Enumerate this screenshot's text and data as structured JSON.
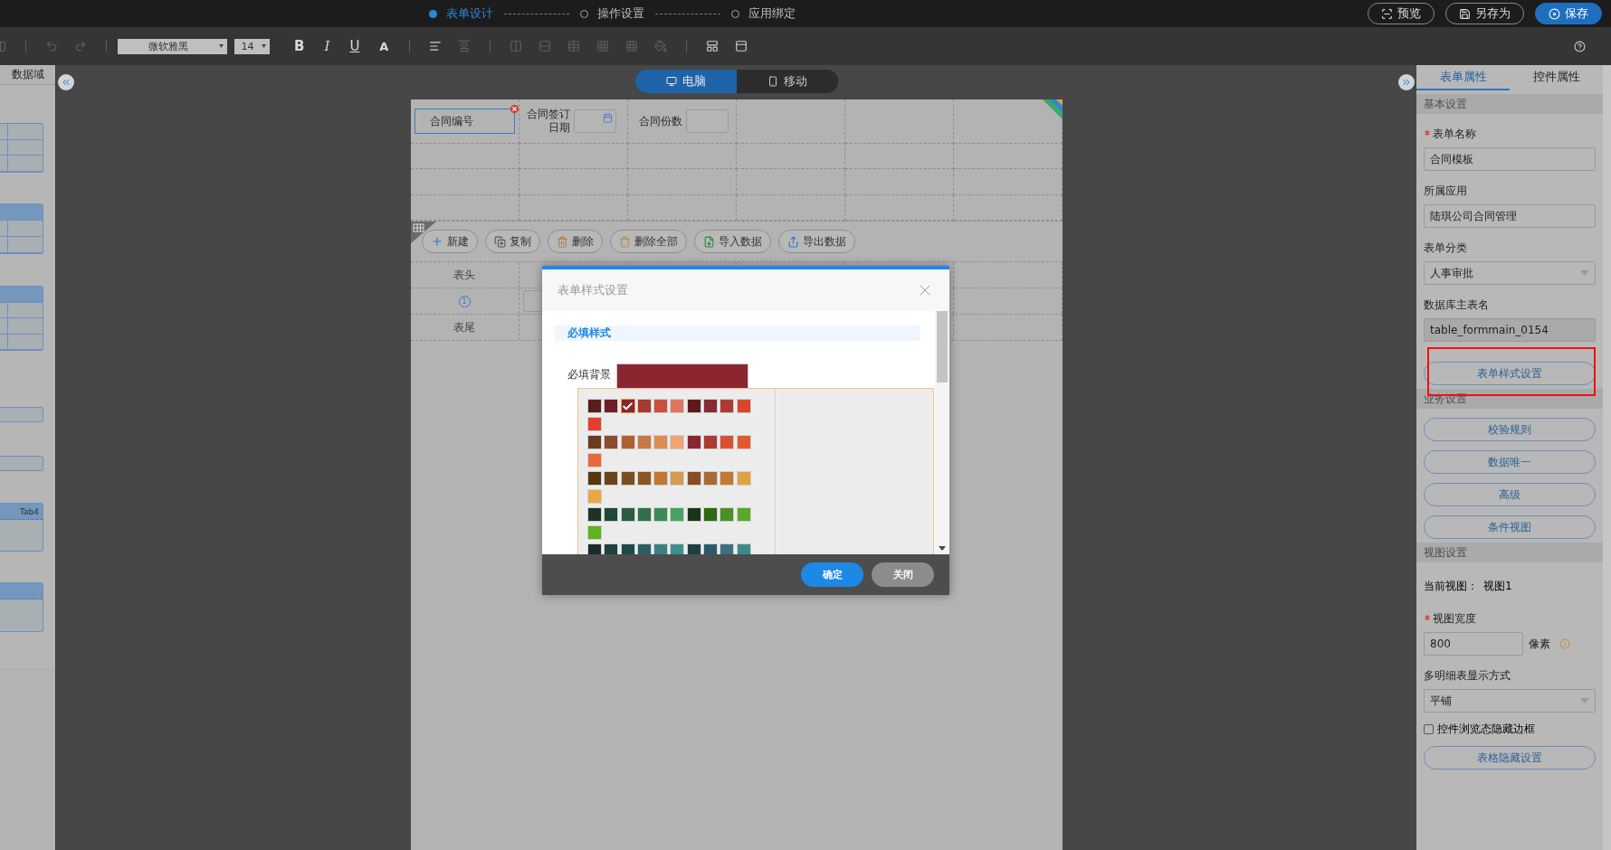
{
  "steps": [
    {
      "label": "表单设计",
      "selected": true
    },
    {
      "label": "操作设置",
      "selected": false
    },
    {
      "label": "应用绑定",
      "selected": false
    }
  ],
  "header_buttons": [
    {
      "label": "预览",
      "kind": "preview"
    },
    {
      "label": "另存为",
      "kind": "save-as"
    },
    {
      "label": "保存",
      "kind": "save"
    }
  ],
  "toolbar": {
    "font": "微软雅黑",
    "size": "14",
    "format": [
      {
        "label": "B",
        "kind": "bold"
      },
      {
        "label": "I",
        "kind": "italic"
      },
      {
        "label": "U",
        "kind": "underline"
      },
      {
        "label": "A",
        "kind": "color"
      }
    ]
  },
  "left_panel": {
    "title": "数据域",
    "thumbnails": [
      {
        "kind": "grid"
      },
      {
        "kind": "grid-header"
      },
      {
        "kind": "grid-header-tall"
      },
      {
        "kind": "field"
      },
      {
        "kind": "field"
      },
      {
        "kind": "tabs",
        "label": "Tab4"
      },
      {
        "kind": "panel"
      }
    ]
  },
  "device_tabs": [
    {
      "label": "电脑",
      "kind": "desktop",
      "selected": true
    },
    {
      "label": "移动",
      "kind": "mobile",
      "selected": false
    }
  ],
  "form": {
    "fields": [
      {
        "label": "合同编号",
        "kind": "text",
        "selected": true
      },
      {
        "label": "合同签订日期",
        "kind": "date",
        "selected": false
      },
      {
        "label": "合同份数",
        "kind": "number",
        "selected": false
      }
    ],
    "detail_toolbar": [
      {
        "label": "新建",
        "kind": "add"
      },
      {
        "label": "复制",
        "kind": "copy"
      },
      {
        "label": "删除",
        "kind": "delete"
      },
      {
        "label": "删除全部",
        "kind": "delete-all"
      },
      {
        "label": "导入数据",
        "kind": "import"
      },
      {
        "label": "导出数据",
        "kind": "export"
      }
    ],
    "detail_rows": [
      {
        "label": "表头",
        "kind": "text"
      },
      {
        "label": "1",
        "kind": "index"
      },
      {
        "label": "表尾",
        "kind": "text"
      }
    ]
  },
  "dialog": {
    "title": "表单样式设置",
    "section": "必填样式",
    "field_label": "必填背景",
    "swatch_groups": [
      {
        "swatches": [
          {
            "color": "#5a1c1c",
            "selected": false
          },
          {
            "color": "#6e1e26",
            "selected": false
          },
          {
            "color": "#8b2530",
            "selected": true
          },
          {
            "color": "#a83832",
            "selected": false
          },
          {
            "color": "#c9503e",
            "selected": false
          },
          {
            "color": "#e07562",
            "selected": false
          },
          {
            "color": "#5e1a1a",
            "selected": false
          },
          {
            "color": "#872a36",
            "selected": false
          },
          {
            "color": "#b03a32",
            "selected": false
          },
          {
            "color": "#d8452a",
            "selected": false
          },
          {
            "color": "#e3402a",
            "selected": false
          }
        ]
      },
      {
        "swatches": [
          {
            "color": "#6a3c1c",
            "selected": false
          },
          {
            "color": "#8c4a2e",
            "selected": false
          },
          {
            "color": "#b0602e",
            "selected": false
          },
          {
            "color": "#c87844",
            "selected": false
          },
          {
            "color": "#e08a54",
            "selected": false
          },
          {
            "color": "#f0a474",
            "selected": false
          },
          {
            "color": "#8b2530",
            "selected": false
          },
          {
            "color": "#b03a32",
            "selected": false
          },
          {
            "color": "#d85232",
            "selected": false
          },
          {
            "color": "#e05a2c",
            "selected": false
          },
          {
            "color": "#e86a3c",
            "selected": false
          }
        ]
      },
      {
        "swatches": [
          {
            "color": "#56380e",
            "selected": false
          },
          {
            "color": "#6a4418",
            "selected": false
          },
          {
            "color": "#7a4e1e",
            "selected": false
          },
          {
            "color": "#8e5522",
            "selected": false
          },
          {
            "color": "#c07832",
            "selected": false
          },
          {
            "color": "#d89a52",
            "selected": false
          },
          {
            "color": "#8a4c22",
            "selected": false
          },
          {
            "color": "#a86a32",
            "selected": false
          },
          {
            "color": "#c07a32",
            "selected": false
          },
          {
            "color": "#e0a244",
            "selected": false
          },
          {
            "color": "#e8a848",
            "selected": false
          }
        ]
      },
      {
        "swatches": [
          {
            "color": "#1c3222",
            "selected": false
          },
          {
            "color": "#1e4838",
            "selected": false
          },
          {
            "color": "#2a5c42",
            "selected": false
          },
          {
            "color": "#2e7048",
            "selected": false
          },
          {
            "color": "#3a8a5a",
            "selected": false
          },
          {
            "color": "#48a062",
            "selected": false
          },
          {
            "color": "#1a3518",
            "selected": false
          },
          {
            "color": "#2e6a10",
            "selected": false
          },
          {
            "color": "#4a9022",
            "selected": false
          },
          {
            "color": "#5aa82a",
            "selected": false
          },
          {
            "color": "#5eb41e",
            "selected": false
          }
        ]
      },
      {
        "swatches": [
          {
            "color": "#1c2a2a",
            "selected": false
          },
          {
            "color": "#1e4040",
            "selected": false
          },
          {
            "color": "#1e4a4a",
            "selected": false
          },
          {
            "color": "#2a6062",
            "selected": false
          },
          {
            "color": "#3a8082",
            "selected": false
          },
          {
            "color": "#3a9090",
            "selected": false
          },
          {
            "color": "#1a4040",
            "selected": false
          },
          {
            "color": "#2a5a6a",
            "selected": false
          },
          {
            "color": "#3a7080",
            "selected": false
          },
          {
            "color": "#3a8a8a",
            "selected": false
          }
        ]
      }
    ],
    "buttons": [
      {
        "label": "确定",
        "kind": "primary"
      },
      {
        "label": "关闭",
        "kind": "secondary"
      }
    ]
  },
  "right_panel": {
    "tabs": [
      {
        "label": "表单属性",
        "selected": true
      },
      {
        "label": "控件属性",
        "selected": false
      }
    ],
    "items": [
      {
        "kind": "section",
        "label": "基本设置"
      },
      {
        "kind": "input",
        "label": "表单名称",
        "required": true,
        "value": "合同模板"
      },
      {
        "kind": "input",
        "label": "所属应用",
        "required": false,
        "value": "陆琪公司合同管理"
      },
      {
        "kind": "select",
        "label": "表单分类",
        "required": false,
        "value": "人事审批"
      },
      {
        "kind": "readonly",
        "label": "数据库主表名",
        "required": false,
        "value": "table_formmain_0154"
      },
      {
        "kind": "button",
        "label": "表单样式设置",
        "highlighted": true
      },
      {
        "kind": "section",
        "label": "业务设置"
      },
      {
        "kind": "button",
        "label": "校验规则",
        "highlighted": false
      },
      {
        "kind": "button",
        "label": "数据唯一",
        "highlighted": false
      },
      {
        "kind": "button",
        "label": "高级",
        "highlighted": false
      },
      {
        "kind": "button",
        "label": "条件视图",
        "highlighted": false
      },
      {
        "kind": "section",
        "label": "视图设置"
      },
      {
        "kind": "info",
        "label": "当前视图：",
        "value": "视图1"
      },
      {
        "kind": "width",
        "label": "视图宽度",
        "required": true,
        "value": "800",
        "unit": "像素"
      },
      {
        "kind": "select",
        "label": "多明细表显示方式",
        "required": false,
        "value": "平铺"
      },
      {
        "kind": "checkbox",
        "label": "控件浏览态隐藏边框",
        "checked": false
      },
      {
        "kind": "button",
        "label": "表格隐藏设置",
        "highlighted": false
      }
    ]
  }
}
